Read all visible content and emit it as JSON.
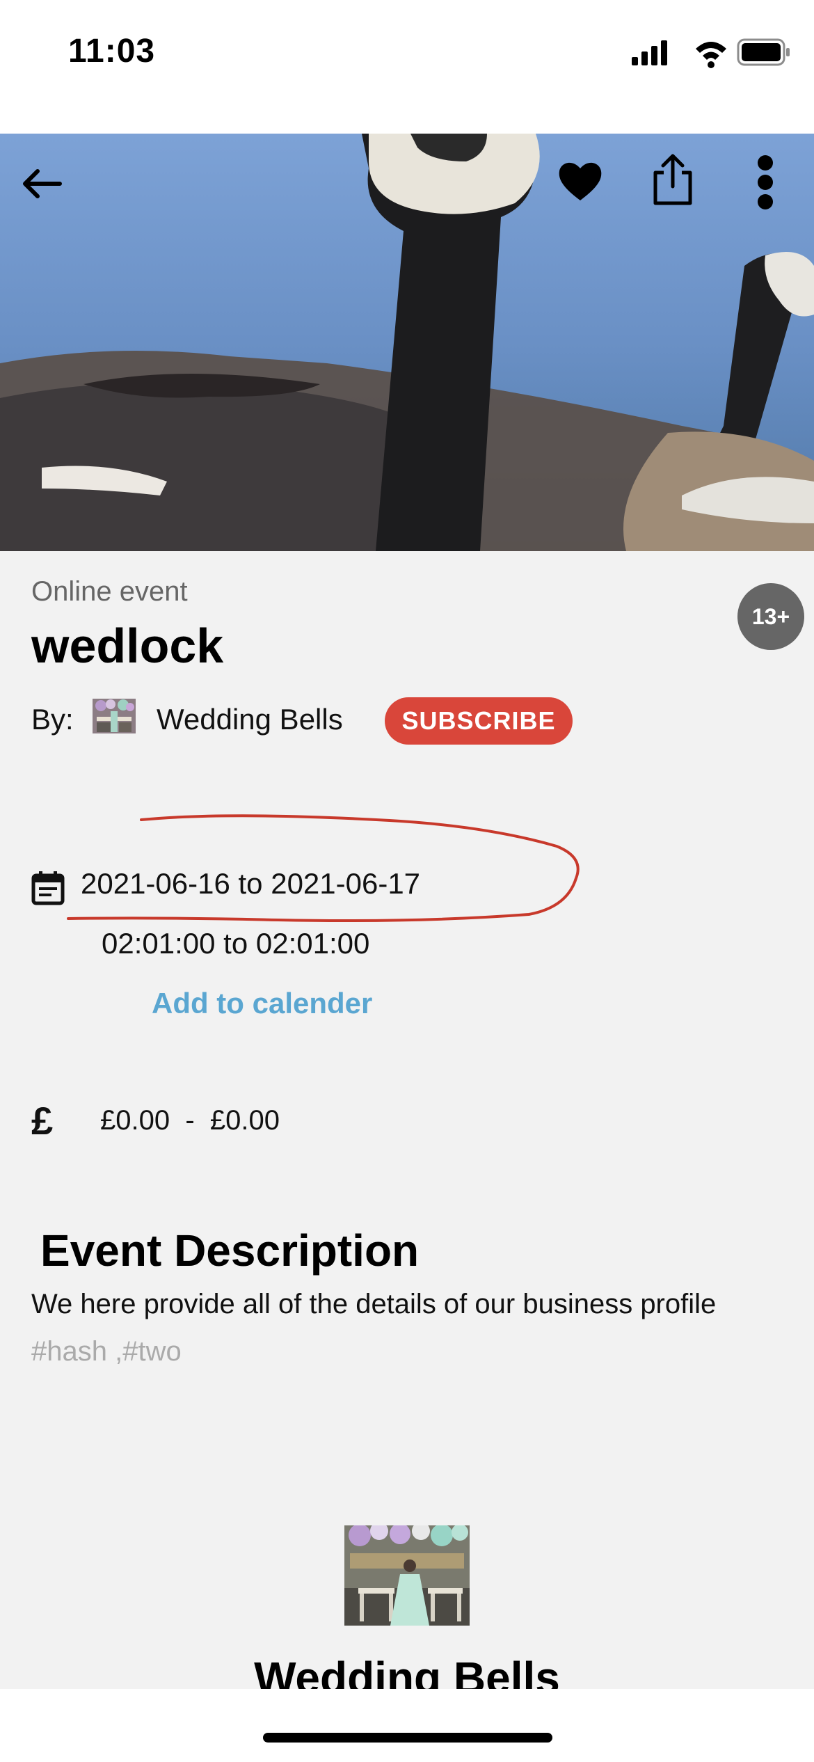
{
  "status_bar": {
    "time": "11:03"
  },
  "hero": {
    "back_icon": "arrow-left-icon",
    "like_icon": "heart-icon",
    "share_icon": "share-icon",
    "more_icon": "more-vertical-icon"
  },
  "event": {
    "type": "Online event",
    "title": "wedlock",
    "age_badge": "13+",
    "by_label": "By:",
    "organizer_name": "Wedding Bells",
    "subscribe_label": "SUBSCRIBE",
    "date_range": "2021-06-16 to 2021-06-17",
    "time_range": "02:01:00 to 02:01:00",
    "add_calendar_label": "Add to calender",
    "currency_symbol": "£",
    "price_range": "£0.00  -  £0.00"
  },
  "description": {
    "heading": "Event Description",
    "body": "We here provide all of the details of our business profile",
    "tags": "#hash ,#two"
  },
  "organizer_section": {
    "heading": "Wedding Bells"
  },
  "colors": {
    "accent_red": "#d9463a",
    "link_blue": "#5aa6d1",
    "badge_gray": "#666666",
    "annotation_red": "#c8392b"
  }
}
